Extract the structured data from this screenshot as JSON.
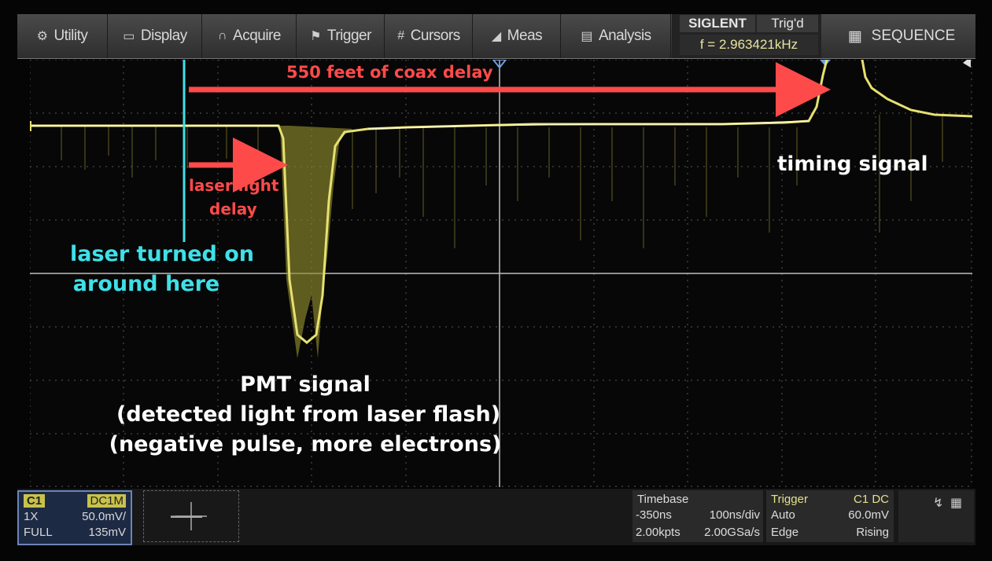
{
  "menu": {
    "utility": "Utility",
    "display": "Display",
    "acquire": "Acquire",
    "trigger": "Trigger",
    "cursors": "Cursors",
    "meas": "Meas",
    "analysis": "Analysis",
    "sequence": "SEQUENCE"
  },
  "brand": "SIGLENT",
  "trigger_state": "Trig'd",
  "frequency": "f = 2.963421kHz",
  "annotations": {
    "coax_delay": "550 feet of coax delay",
    "laser_delay_line1": "laser light",
    "laser_delay_line2": "delay",
    "laser_on_line1": "laser turned on",
    "laser_on_line2": "around here",
    "pmt_line1": "PMT signal",
    "pmt_line2": "(detected light from laser flash)",
    "pmt_line3": "(negative pulse, more electrons)",
    "timing": "timing signal"
  },
  "channel": {
    "name": "C1",
    "coupling": "DC1M",
    "probe": "1X",
    "scale": "50.0mV/",
    "bandwidth": "FULL",
    "offset": "135mV"
  },
  "timebase": {
    "title": "Timebase",
    "delay": "-350ns",
    "scale": "100ns/div",
    "points": "2.00kpts",
    "sample_rate": "2.00GSa/s"
  },
  "trigger_box": {
    "title": "Trigger",
    "source": "C1 DC",
    "mode": "Auto",
    "level": "60.0mV",
    "type": "Edge",
    "slope": "Rising"
  },
  "colors": {
    "trace": "#e6e070",
    "annotation_red": "#ff4a4a",
    "annotation_cyan": "#3fe0e8"
  }
}
